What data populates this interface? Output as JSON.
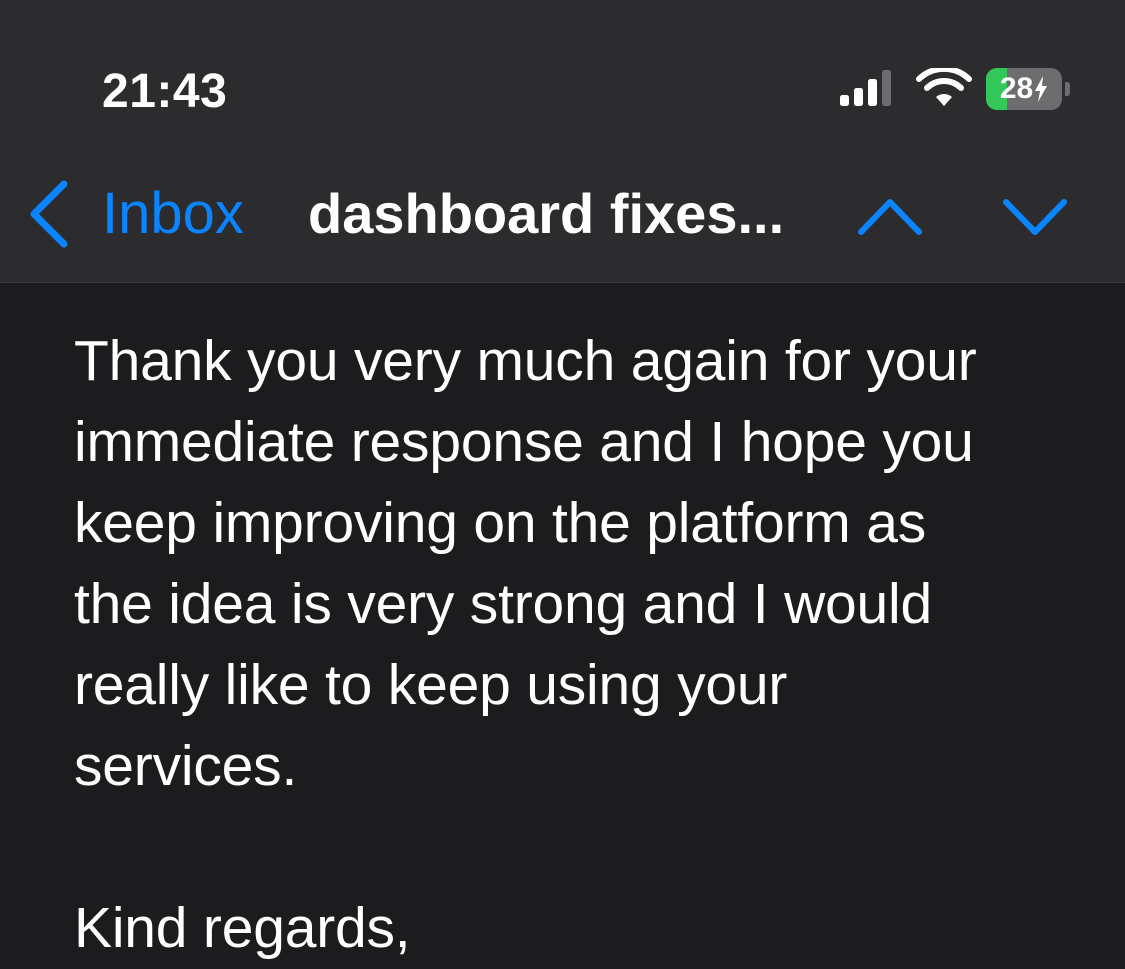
{
  "status_bar": {
    "time": "21:43",
    "signal_icon": "cellular-signal-icon",
    "wifi_icon": "wifi-icon",
    "battery": {
      "percent_label": "28",
      "charge_fraction": 0.28,
      "charging": true,
      "color": "#34c759"
    }
  },
  "nav_bar": {
    "back_label": "Inbox",
    "title": "dashboard fixes...",
    "prev_icon": "chevron-up-icon",
    "next_icon": "chevron-down-icon",
    "accent_color": "#0a84ff"
  },
  "email": {
    "body_lines": [
      "Thank you very much again for your",
      "immediate response and I hope you",
      "keep improving on the platform as",
      "the idea is very strong and I would",
      "really like to keep using your",
      "services."
    ],
    "sign_off": "Kind regards,"
  }
}
